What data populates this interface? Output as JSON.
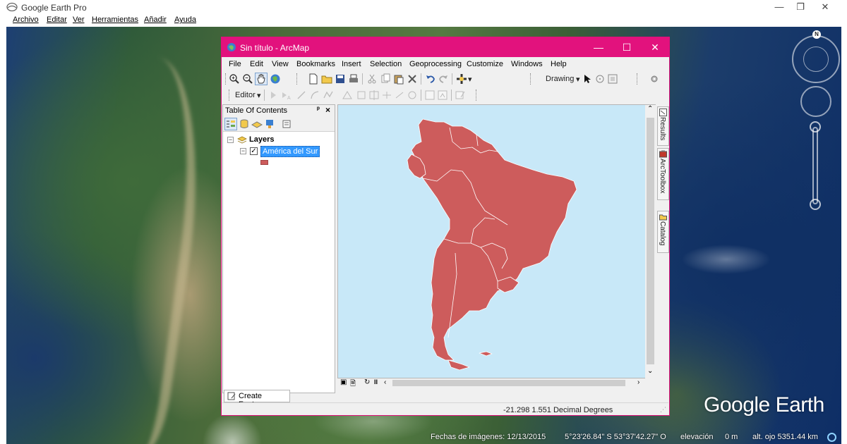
{
  "google_earth": {
    "title": "Google Earth Pro",
    "menu": [
      "Archivo",
      "Editar",
      "Ver",
      "Herramientas",
      "Añadir",
      "Ayuda"
    ],
    "logo": "Google Earth",
    "compass_north": "N",
    "status": {
      "imagery_date": "Fechas de imágenes: 12/13/2015",
      "coordinates": "5°23'26.84\" S   53°37'42.27\" O",
      "elevation_label": "elevación",
      "elevation_value": "0 m",
      "eye_altitude": "alt. ojo 5351.44 km"
    }
  },
  "arcmap": {
    "title": "Sin título - ArcMap",
    "menu": [
      "File",
      "Edit",
      "View",
      "Bookmarks",
      "Insert",
      "Selection",
      "Geoprocessing",
      "Customize",
      "Windows",
      "Help"
    ],
    "toolbar": {
      "drawing_label": "Drawing",
      "editor_label": "Editor"
    },
    "toc": {
      "title": "Table Of Contents",
      "pin": "ᵖ",
      "close": "×",
      "root_layer": "Layers",
      "layer_name": "América del Sur",
      "layer_checked": true,
      "layer_color": "#cd5c5c"
    },
    "side_tabs": [
      "Results",
      "ArcToolbox",
      "Catalog"
    ],
    "create_features_label": "Create Features",
    "status_coords": "-21.298  1.551 Decimal Degrees",
    "colors": {
      "accent": "#e2127d",
      "map_background": "#c8e8f8",
      "selection": "#3399ff"
    }
  }
}
